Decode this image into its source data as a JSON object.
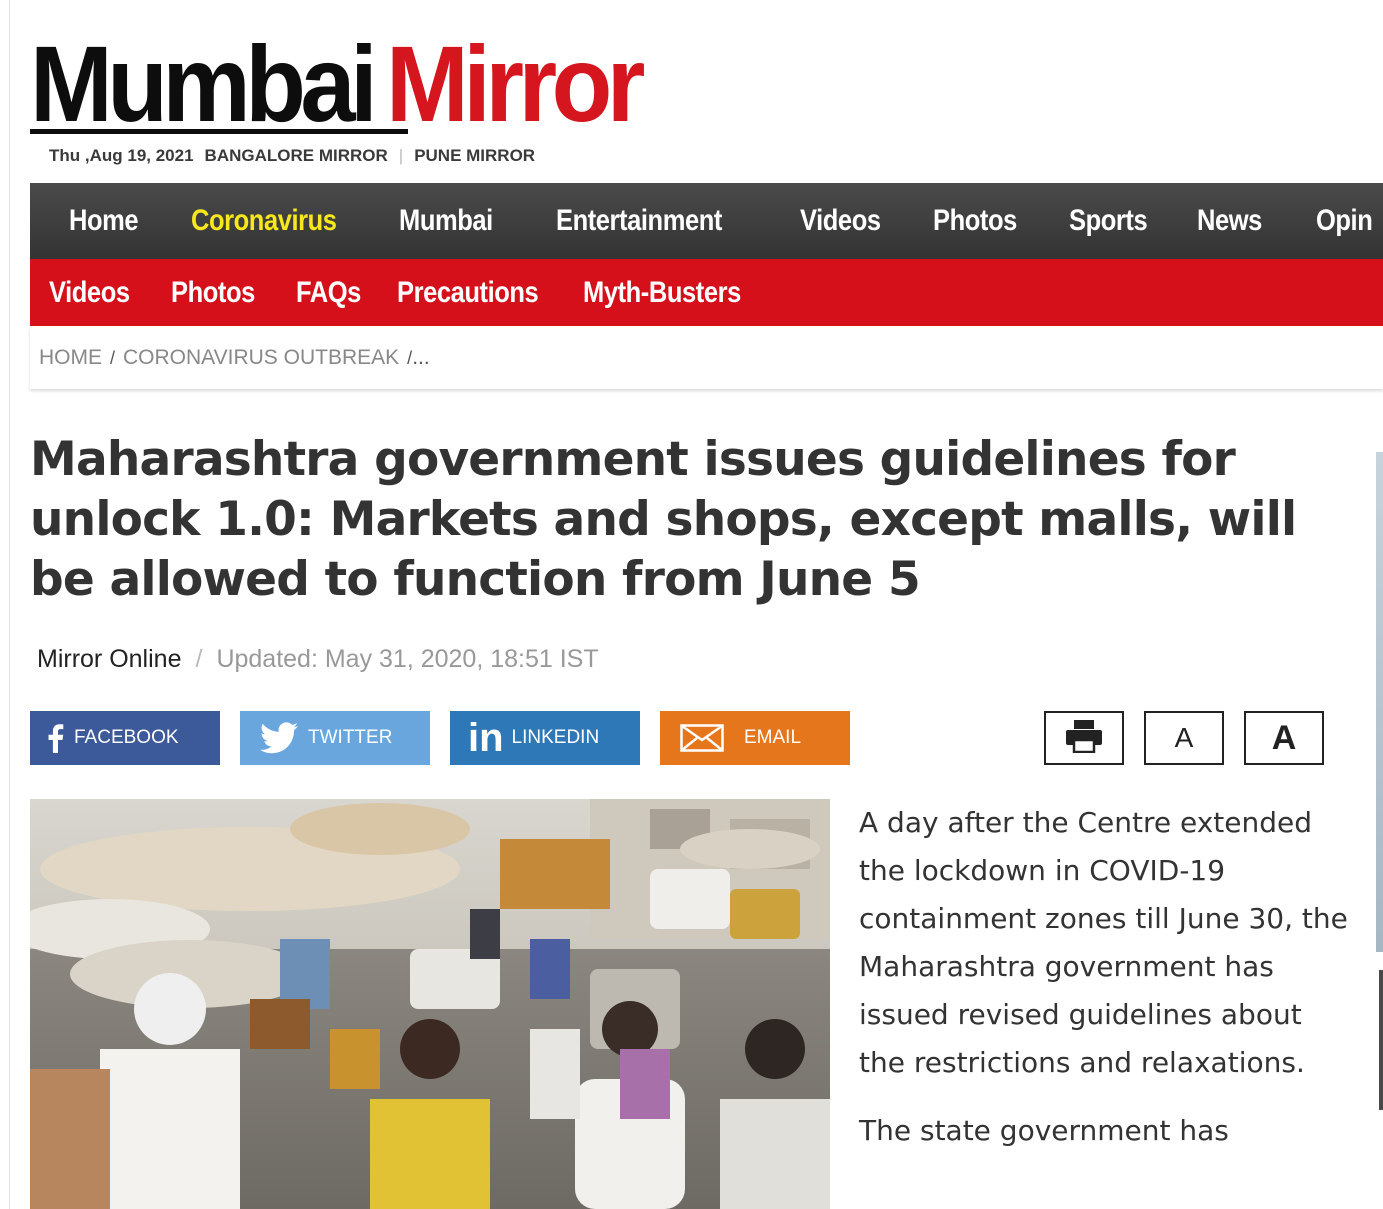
{
  "masthead": {
    "logo_word1": "Mumbai",
    "logo_word2": "Mirror",
    "date": "Thu ,Aug 19, 2021",
    "sister_site_1": "BANGALORE MIRROR",
    "sister_site_2": "PUNE MIRROR"
  },
  "nav_main": [
    "Home",
    "Coronavirus",
    "Mumbai",
    "Entertainment",
    "Videos",
    "Photos",
    "Sports",
    "News",
    "Opin"
  ],
  "nav_main_active": "Coronavirus",
  "nav_sub": [
    "Videos",
    "Photos",
    "FAQs",
    "Precautions",
    "Myth-Busters"
  ],
  "breadcrumb": {
    "home": "HOME",
    "section": "CORONAVIRUS OUTBREAK",
    "more": "..."
  },
  "article": {
    "headline": "Maharashtra government issues guidelines for unlock 1.0: Markets and shops, except malls, will be allowed to function from June 5",
    "author": "Mirror Online",
    "updated": "Updated: May 31, 2020, 18:51 IST",
    "paragraphs": [
      "A day after the Centre extended the lockdown in COVID-19 containment zones till June 30, the Maharashtra government has issued revised guidelines about the restrictions and relaxations.",
      "The state government has"
    ]
  },
  "share": {
    "facebook": "FACEBOOK",
    "twitter": "TWITTER",
    "linkedin": "LINKEDIN",
    "email": "EMAIL"
  },
  "tools": {
    "font_small": "A",
    "font_large": "A"
  },
  "colors": {
    "brand_red": "#d5161e",
    "nav_dark": "#3a3a3a",
    "active_nav": "#f7e71c",
    "facebook": "#3c5a99",
    "twitter": "#6aa6de",
    "linkedin": "#2f78b8",
    "email": "#e6761c"
  },
  "icons": [
    "facebook-icon",
    "twitter-icon",
    "linkedin-icon",
    "email-icon",
    "print-icon"
  ]
}
